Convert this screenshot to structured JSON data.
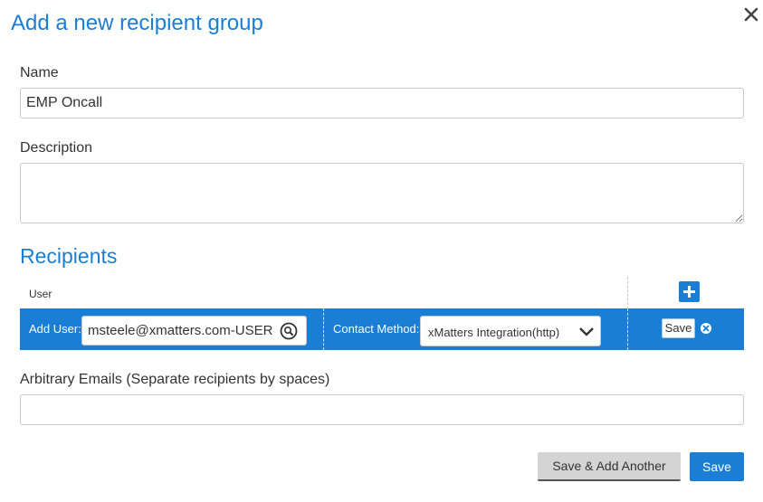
{
  "dialog": {
    "title": "Add a new recipient group",
    "close_icon": "close-icon"
  },
  "form": {
    "name_label": "Name",
    "name_value": "EMP Oncall",
    "description_label": "Description",
    "description_value": "",
    "arbitrary_emails_label": "Arbitrary Emails (Separate recipients by spaces)",
    "arbitrary_emails_value": ""
  },
  "recipients": {
    "section_title": "Recipients",
    "column_header": "User",
    "add_row_icon": "plus-icon",
    "row": {
      "add_user_label": "Add User:",
      "user_value": "msteele@xmatters.com-USER",
      "lookup_icon": "search-icon",
      "contact_method_label": "Contact Method:",
      "contact_method_value": "xMatters Integration(http)",
      "save_label": "Save",
      "remove_icon": "remove-circle-icon"
    }
  },
  "footer": {
    "save_add_another_label": "Save & Add Another",
    "save_label": "Save"
  },
  "colors": {
    "accent": "#1a7fd4",
    "secondary_button": "#d4d4d4"
  }
}
